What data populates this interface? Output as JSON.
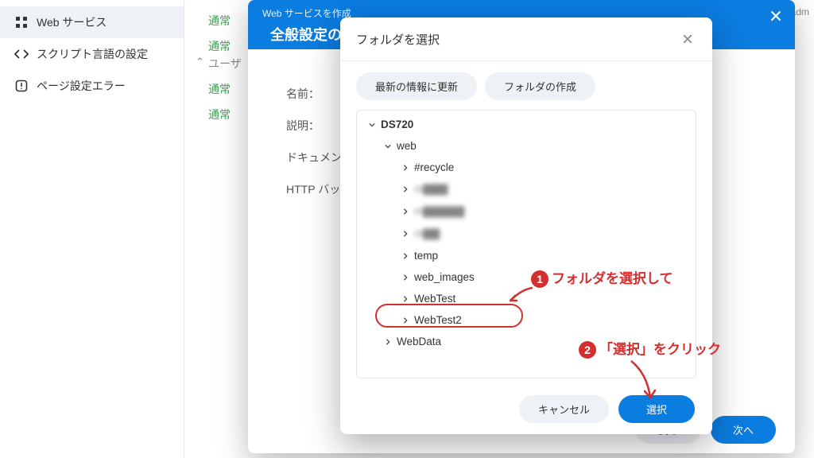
{
  "sidebar": {
    "items": [
      {
        "label": "Web サービス"
      },
      {
        "label": "スクリプト言語の設定"
      },
      {
        "label": "ページ設定エラー"
      }
    ]
  },
  "background": {
    "rows": [
      "通常",
      "通常",
      "通常",
      "通常"
    ],
    "user_section": "ユーザ",
    "right_hint": "adm"
  },
  "outer_modal": {
    "small_title": "Web サービスを作成",
    "big_title": "全般設定の",
    "rows": {
      "name": "名前：",
      "desc": "説明：",
      "doc": "ドキュメン",
      "http": "HTTP バック"
    },
    "footer": {
      "back": "戻る",
      "next": "次へ"
    }
  },
  "picker": {
    "title": "フォルダを選択",
    "toolbar": {
      "refresh": "最新の情報に更新",
      "create": "フォルダの作成"
    },
    "tree": {
      "root": "DS720",
      "l1": "web",
      "children": [
        "#recycle",
        "m▇▇▇",
        "m▇▇▇▇▇",
        "m▇▇",
        "temp",
        "web_images",
        "WebTest",
        "WebTest2"
      ],
      "l1b": "WebData"
    },
    "footer": {
      "cancel": "キャンセル",
      "select": "選択"
    }
  },
  "annotations": {
    "a1": "フォルダを選択して",
    "a2": "「選択」をクリック"
  }
}
